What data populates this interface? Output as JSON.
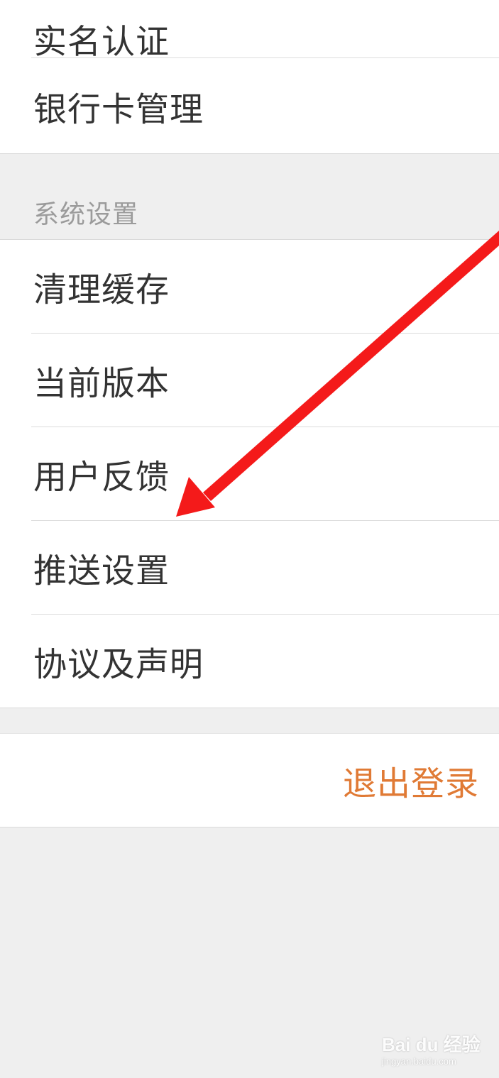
{
  "account_section": {
    "items": [
      {
        "label": "实名认证"
      },
      {
        "label": "银行卡管理"
      }
    ]
  },
  "system_section": {
    "header": "系统设置",
    "items": [
      {
        "label": "清理缓存"
      },
      {
        "label": "当前版本"
      },
      {
        "label": "用户反馈"
      },
      {
        "label": "推送设置"
      },
      {
        "label": "协议及声明"
      }
    ]
  },
  "logout": {
    "label": "退出登录",
    "color": "#e07a35"
  },
  "annotation": {
    "arrow_color": "#f41a1a"
  },
  "watermark": {
    "brand": "Bai du 经验",
    "url": "jingyan.baidu.com"
  },
  "colors": {
    "background": "#efefef",
    "row_background": "#ffffff",
    "text_primary": "#333333",
    "text_section_header": "#9b9b9b"
  }
}
